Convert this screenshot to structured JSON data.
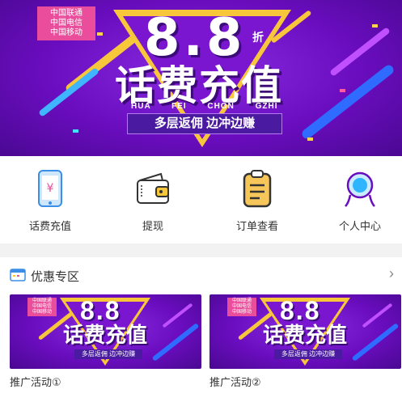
{
  "banner": {
    "carriers": [
      "中国联通",
      "中国电信",
      "中国移动"
    ],
    "number": "8.8",
    "discount_unit": "折",
    "headline": "话费充值",
    "pinyin": "HUA FEI CHON GZHI",
    "slogan": "多层返佣  边冲边赚"
  },
  "quick_actions": [
    {
      "label": "话费充值",
      "icon": "phone-recharge-icon"
    },
    {
      "label": "提现",
      "icon": "wallet-icon"
    },
    {
      "label": "订单查看",
      "icon": "clipboard-icon"
    },
    {
      "label": "个人中心",
      "icon": "user-icon"
    }
  ],
  "promo": {
    "title": "优惠专区",
    "cards": [
      {
        "label": "推广活动①"
      },
      {
        "label": "推广活动②"
      }
    ]
  },
  "colors": {
    "banner_purple": "#6a0dbf",
    "accent_yellow": "#f8c63a",
    "carrier_pink": "#e94d9c"
  }
}
